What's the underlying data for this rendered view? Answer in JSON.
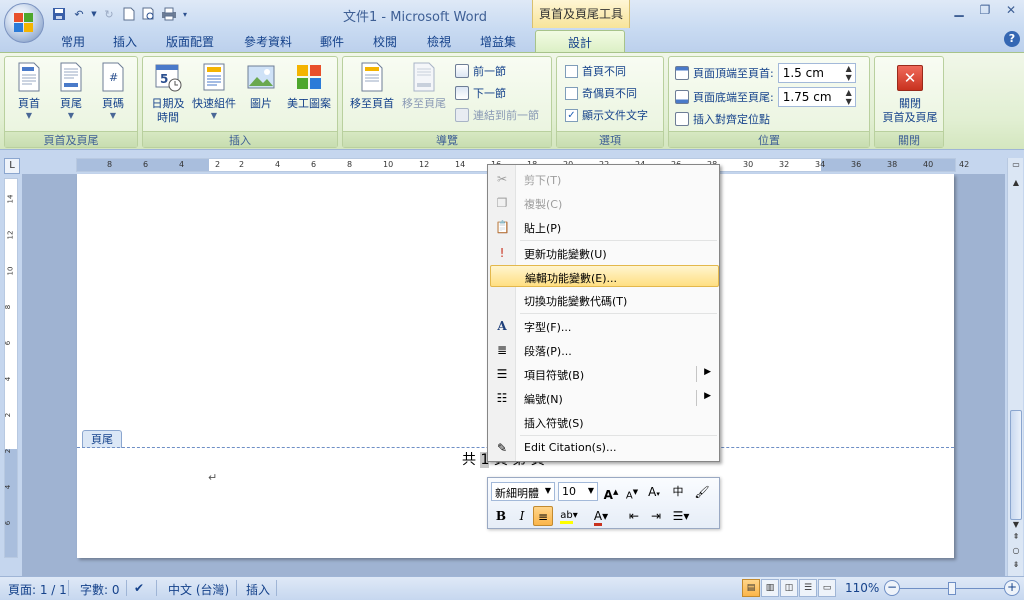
{
  "window": {
    "title": "文件1 - Microsoft Word",
    "context_tab_title": "頁首及頁尾工具"
  },
  "tabs": [
    "常用",
    "插入",
    "版面配置",
    "參考資料",
    "郵件",
    "校閱",
    "檢視",
    "增益集",
    "設計"
  ],
  "active_tab": "設計",
  "ribbon": {
    "groups": {
      "header_footer": {
        "label": "頁首及頁尾",
        "header": "頁首",
        "footer": "頁尾",
        "page_number": "頁碼"
      },
      "insert": {
        "label": "插入",
        "date_time_l1": "日期及",
        "date_time_l2": "時間",
        "quick_parts": "快速組件",
        "picture": "圖片",
        "clip_art": "美工圖案"
      },
      "navigation": {
        "label": "導覽",
        "goto_header": "移至頁首",
        "goto_footer": "移至頁尾",
        "previous": "前一節",
        "next": "下一節",
        "link_previous": "連結到前一節"
      },
      "options": {
        "label": "選項",
        "different_first": "首頁不同",
        "different_odd_even": "奇偶頁不同",
        "show_doc_text": "顯示文件文字"
      },
      "position": {
        "label": "位置",
        "header_from_top": "頁面頂端至頁首:",
        "header_from_top_value": "1.5 cm",
        "footer_from_bottom": "頁面底端至頁尾:",
        "footer_from_bottom_value": "1.75 cm",
        "insert_align_tab": "插入對齊定位點"
      },
      "close": {
        "label": "關閉",
        "close_l1": "關閉",
        "close_l2": "頁首及頁尾"
      }
    }
  },
  "document": {
    "footer_tab_label": "頁尾",
    "footer_text_a": "共",
    "footer_field": "1",
    "footer_text_b": "頁 第 頁",
    "para_mark": "↵"
  },
  "context_menu": {
    "cut": "剪下(T)",
    "copy": "複製(C)",
    "paste": "貼上(P)",
    "update_field": "更新功能變數(U)",
    "edit_field": "編輯功能變數(E)...",
    "toggle_field_codes": "切換功能變數代碼(T)",
    "font": "字型(F)...",
    "paragraph": "段落(P)...",
    "bullets": "項目符號(B)",
    "numbering": "編號(N)",
    "insert_symbol": "插入符號(S)",
    "edit_citation": "Edit Citation(s)..."
  },
  "mini_toolbar": {
    "font_name": "新細明體",
    "font_size": "10"
  },
  "ruler_ticks": [
    "8",
    "6",
    "4",
    "2",
    "2",
    "4",
    "6",
    "8",
    "10",
    "12",
    "14",
    "16",
    "18",
    "20",
    "22",
    "24",
    "26",
    "28",
    "30",
    "32",
    "34",
    "36",
    "38",
    "40",
    "42"
  ],
  "vruler_ticks": [
    "14",
    "12",
    "10",
    "8",
    "6",
    "4",
    "2",
    "2",
    "4",
    "6"
  ],
  "statusbar": {
    "page": "頁面: 1 / 1",
    "words": "字數: 0",
    "language": "中文 (台灣)",
    "mode": "插入",
    "zoom": "110%"
  },
  "colors": {
    "accent": "#15428b",
    "context_highlight": "#ffdf82"
  }
}
